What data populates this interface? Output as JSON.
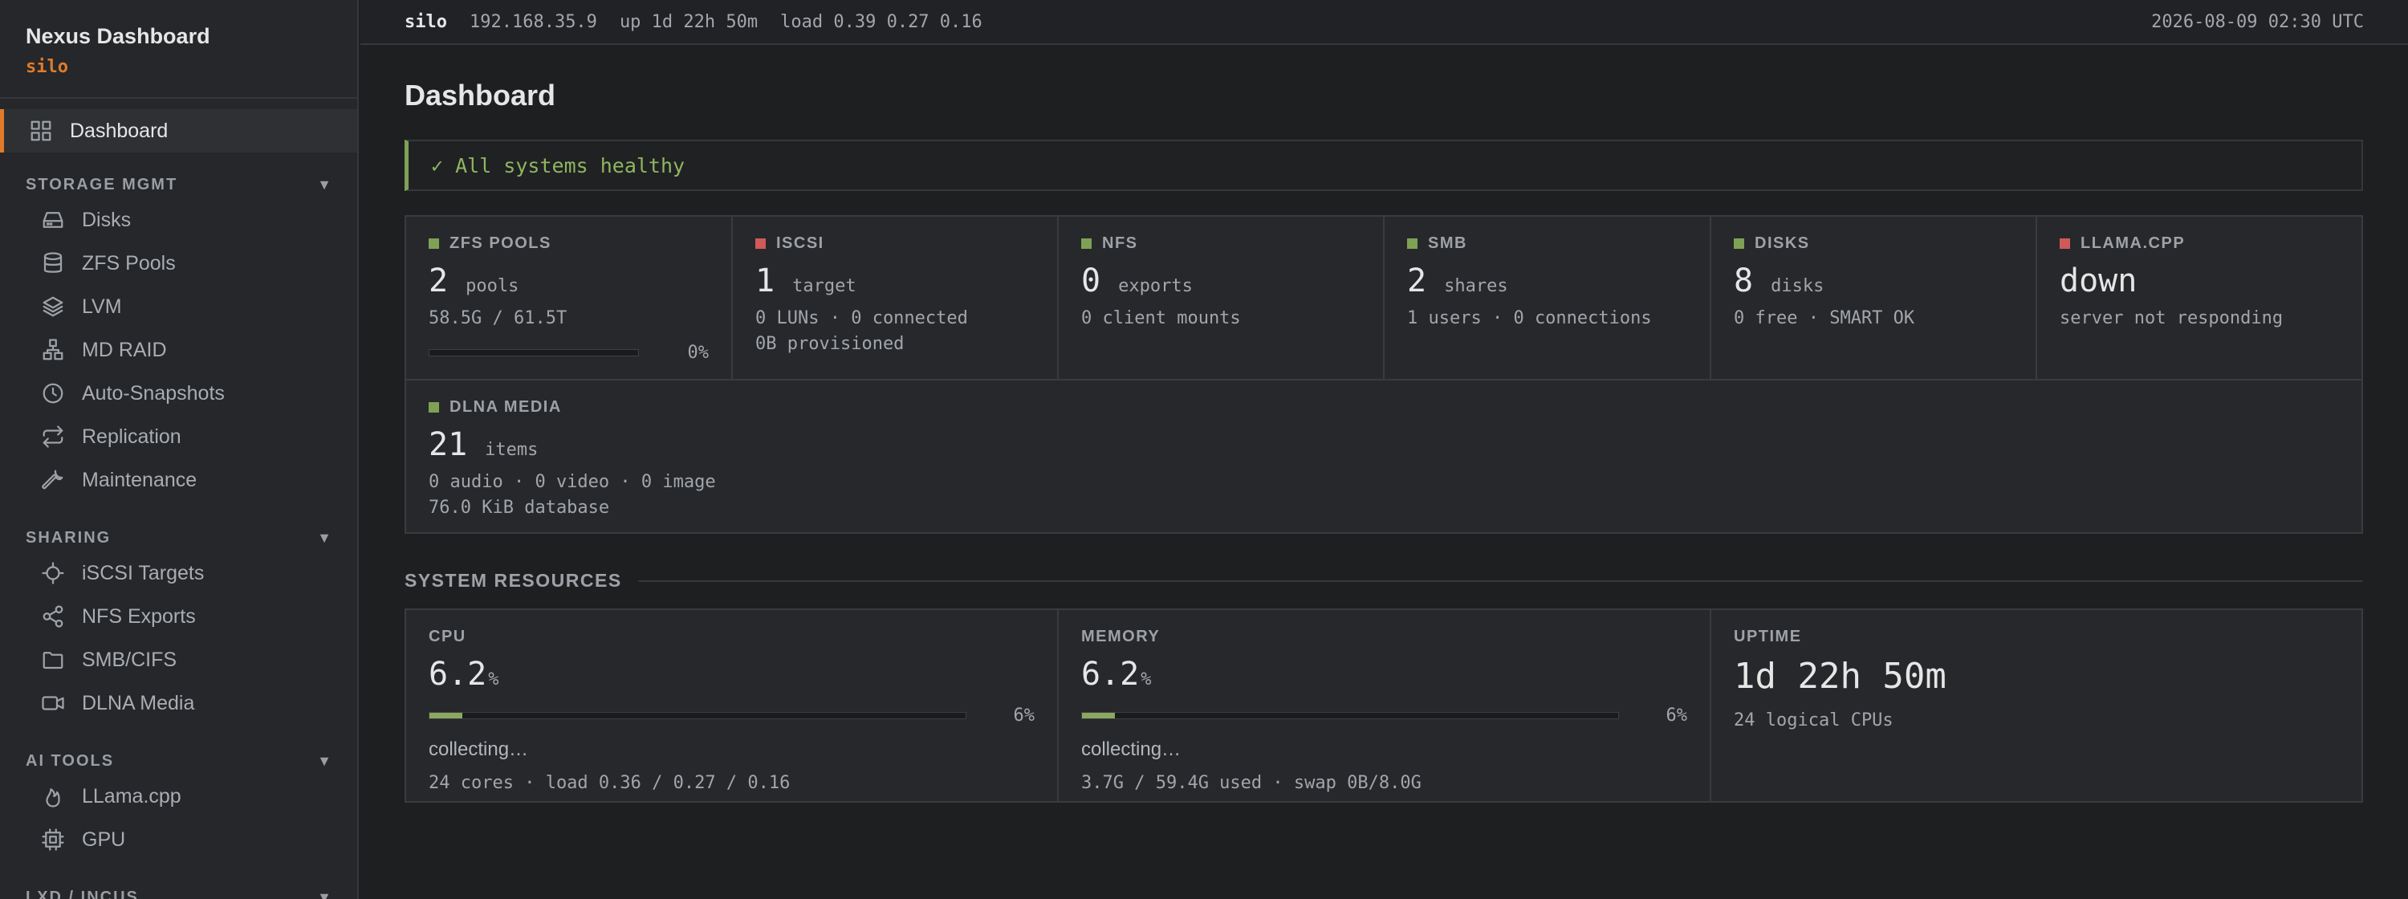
{
  "sidebar": {
    "title": "Nexus Dashboard",
    "host": "silo",
    "dashboard_label": "Dashboard",
    "sections": [
      {
        "title": "STORAGE MGMT",
        "items": [
          {
            "label": "Disks",
            "icon": "disk-icon"
          },
          {
            "label": "ZFS Pools",
            "icon": "database-icon"
          },
          {
            "label": "LVM",
            "icon": "layers-icon"
          },
          {
            "label": "MD RAID",
            "icon": "raid-icon"
          },
          {
            "label": "Auto-Snapshots",
            "icon": "clock-icon"
          },
          {
            "label": "Replication",
            "icon": "repeat-icon"
          },
          {
            "label": "Maintenance",
            "icon": "wrench-icon"
          }
        ]
      },
      {
        "title": "SHARING",
        "items": [
          {
            "label": "iSCSI Targets",
            "icon": "target-icon"
          },
          {
            "label": "NFS Exports",
            "icon": "share-icon"
          },
          {
            "label": "SMB/CIFS",
            "icon": "folder-icon"
          },
          {
            "label": "DLNA Media",
            "icon": "video-icon"
          }
        ]
      },
      {
        "title": "AI TOOLS",
        "items": [
          {
            "label": "LLama.cpp",
            "icon": "flame-icon"
          },
          {
            "label": "GPU",
            "icon": "chip-icon"
          }
        ]
      },
      {
        "title": "LXD / INCUS",
        "items": []
      }
    ]
  },
  "topbar": {
    "host": "silo",
    "ip": "192.168.35.9",
    "uptime": "up 1d 22h 50m",
    "load": "load 0.39 0.27 0.16",
    "datetime": "2026-08-09 02:30 UTC"
  },
  "main": {
    "title": "Dashboard",
    "health": "✓ All systems healthy",
    "services": [
      {
        "name": "ZFS POOLS",
        "status": "ok",
        "count": "2",
        "unit": "pools",
        "lines": [
          "58.5G / 61.5T"
        ],
        "bar_pct_label": "0%",
        "bar_fraction": 0.0
      },
      {
        "name": "ISCSI",
        "status": "error",
        "count": "1",
        "unit": "target",
        "lines": [
          "0 LUNs · 0 connected",
          "0B provisioned"
        ]
      },
      {
        "name": "NFS",
        "status": "ok",
        "count": "0",
        "unit": "exports",
        "lines": [
          "0 client mounts"
        ]
      },
      {
        "name": "SMB",
        "status": "ok",
        "count": "2",
        "unit": "shares",
        "lines": [
          "1 users · 0 connections"
        ]
      },
      {
        "name": "DISKS",
        "status": "ok",
        "count": "8",
        "unit": "disks",
        "lines": [
          "0 free · SMART OK"
        ]
      },
      {
        "name": "LLAMA.CPP",
        "status": "error",
        "word": "down",
        "lines": [
          "server not responding"
        ]
      },
      {
        "name": "DLNA MEDIA",
        "status": "ok",
        "count": "21",
        "unit": "items",
        "lines": [
          "0 audio · 0 video · 0 image",
          "76.0 KiB database"
        ]
      }
    ],
    "resources_heading": "SYSTEM RESOURCES",
    "resources": {
      "cpu": {
        "label": "CPU",
        "value": "6.2",
        "unit": "%",
        "bar_pct_label": "6%",
        "bar_fraction": 0.062,
        "status": "collecting…",
        "detail": "24 cores · load 0.36 / 0.27 / 0.16"
      },
      "memory": {
        "label": "MEMORY",
        "value": "6.2",
        "unit": "%",
        "bar_pct_label": "6%",
        "bar_fraction": 0.062,
        "status": "collecting…",
        "detail": "3.7G / 59.4G used · swap 0B/8.0G"
      },
      "uptime": {
        "label": "UPTIME",
        "value": "1d 22h 50m",
        "detail": "24 logical CPUs"
      }
    }
  },
  "colors": {
    "accent": "#e07b2c",
    "ok": "#7fa155",
    "error": "#d05a5a",
    "healthy_text": "#8fb561",
    "bar_fill": "#8aa85e"
  }
}
